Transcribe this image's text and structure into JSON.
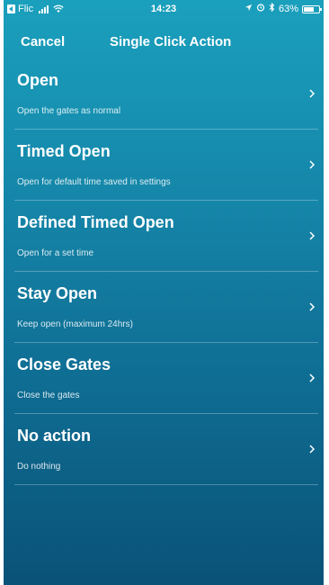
{
  "status_bar": {
    "carrier": "Flic",
    "time": "14:23",
    "battery_percent": "63%",
    "battery_level": 0.63
  },
  "nav": {
    "cancel_label": "Cancel",
    "title": "Single Click Action"
  },
  "actions": [
    {
      "title": "Open",
      "description": "Open the gates as normal"
    },
    {
      "title": "Timed Open",
      "description": "Open for default time saved in settings"
    },
    {
      "title": "Defined Timed Open",
      "description": "Open for a set time"
    },
    {
      "title": "Stay Open",
      "description": "Keep open (maximum 24hrs)"
    },
    {
      "title": "Close Gates",
      "description": "Close the gates"
    },
    {
      "title": "No action",
      "description": "Do nothing"
    }
  ],
  "colors": {
    "gradient_top": "#1aa0bd",
    "gradient_bottom": "#0a5277",
    "text": "#ffffff"
  }
}
